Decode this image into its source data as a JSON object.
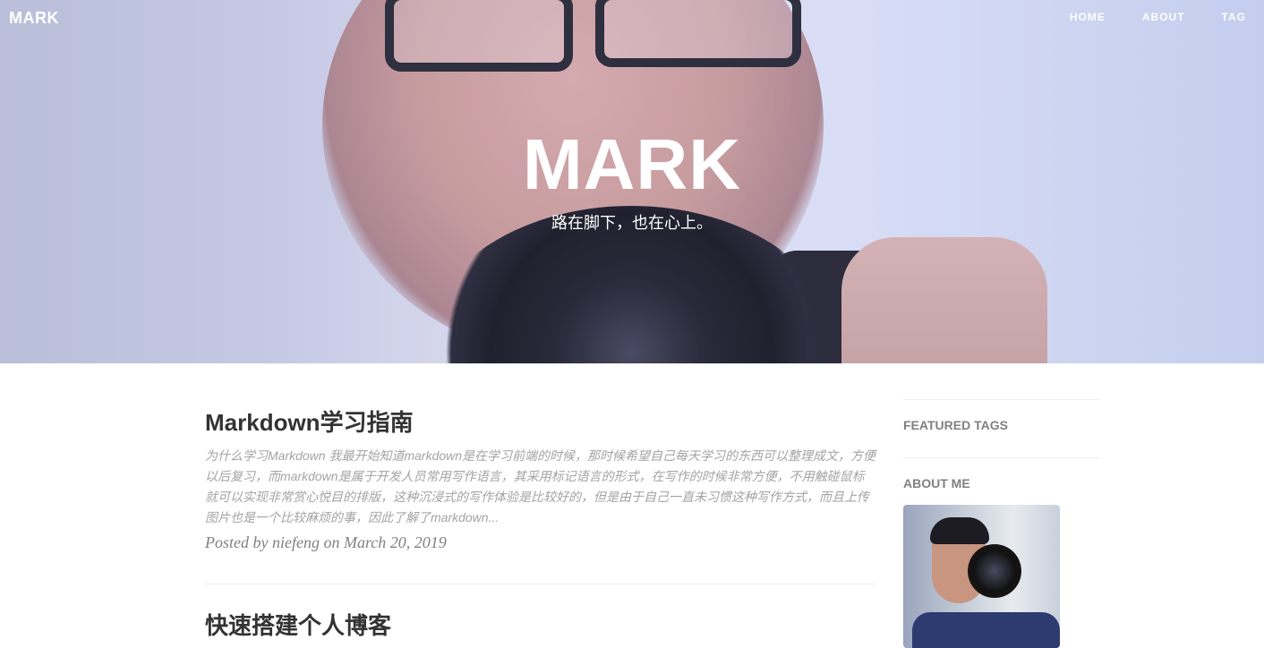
{
  "nav": {
    "brand": "MARK",
    "links": [
      "HOME",
      "ABOUT",
      "TAG"
    ]
  },
  "hero": {
    "title": "MARK",
    "subtitle": "路在脚下，也在心上。"
  },
  "posts": [
    {
      "title": "Markdown学习指南",
      "excerpt": "为什么学习Markdown 我最开始知道markdown是在学习前端的时候，那时候希望自己每天学习的东西可以整理成文，方便以后复习，而markdown是属于开发人员常用写作语言，其采用标记语言的形式，在写作的时候非常方便，不用触碰鼠标就可以实现非常赏心悦目的排版，这种沉浸式的写作体验是比较好的，但是由于自己一直未习惯这种写作方式，而且上传图片也是一个比较麻烦的事，因此了解了markdown...",
      "meta": "Posted by niefeng on March 20, 2019"
    },
    {
      "title": "快速搭建个人博客"
    }
  ],
  "sidebar": {
    "featured_tags": "FEATURED TAGS",
    "about_me": "ABOUT ME"
  }
}
